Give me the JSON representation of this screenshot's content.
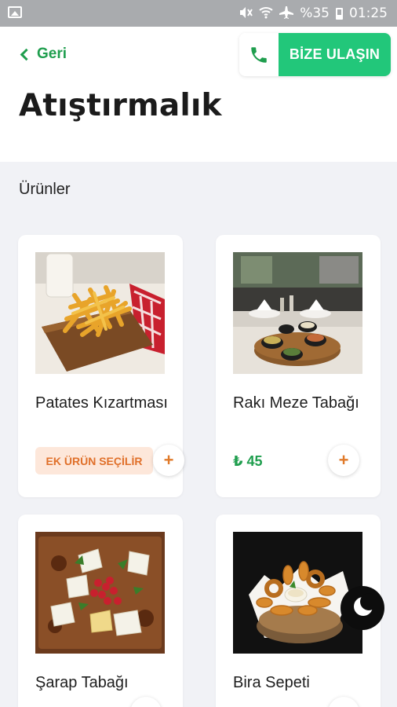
{
  "status_bar": {
    "battery": "%35",
    "time": "01:25",
    "icons": [
      "image-icon",
      "mute-icon",
      "wifi-icon",
      "airplane-icon",
      "battery-icon"
    ]
  },
  "header": {
    "back_label": "Geri",
    "contact_label": "BİZE ULAŞIN",
    "title": "Atıştırmalık"
  },
  "section_title": "Ürünler",
  "products": [
    {
      "name": "Patates Kızartması",
      "badge": "EK ÜRÜN SEÇİLİR",
      "plus": "+"
    },
    {
      "name": "Rakı Meze Tabağı",
      "price": "₺ 45",
      "plus": "+"
    },
    {
      "name": "Şarap Tabağı",
      "plus": "+"
    },
    {
      "name": "Bira Sepeti",
      "plus": "+"
    }
  ],
  "colors": {
    "accent_green": "#1f9e4e",
    "contact_green": "#22c77a",
    "orange": "#e07a2a",
    "badge_bg": "#fde7da",
    "background": "#f1f2f6"
  }
}
